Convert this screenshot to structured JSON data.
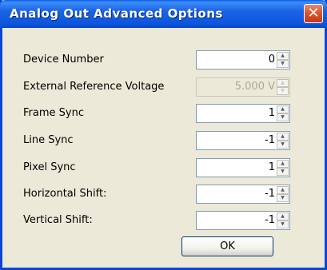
{
  "window": {
    "title": "Analog Out Advanced Options",
    "close_glyph": "✕"
  },
  "fields": [
    {
      "label": "Device Number",
      "value": "0",
      "enabled": true
    },
    {
      "label": "External Reference Voltage",
      "value": "5.000 V",
      "enabled": false
    },
    {
      "label": "Frame Sync",
      "value": "1",
      "enabled": true
    },
    {
      "label": "Line Sync",
      "value": "-1",
      "enabled": true
    },
    {
      "label": "Pixel Sync",
      "value": "1",
      "enabled": true
    },
    {
      "label": "Horizontal Shift:",
      "value": "-1",
      "enabled": true
    },
    {
      "label": "Vertical Shift:",
      "value": "-1",
      "enabled": true
    }
  ],
  "arrows": {
    "up": "▲",
    "down": "▼"
  },
  "ok_label": "OK",
  "colors": {
    "titlebar": "#0a5ee8",
    "dialog_bg": "#ece9d8",
    "close_button": "#d8542c",
    "field_border": "#7f9db9"
  }
}
